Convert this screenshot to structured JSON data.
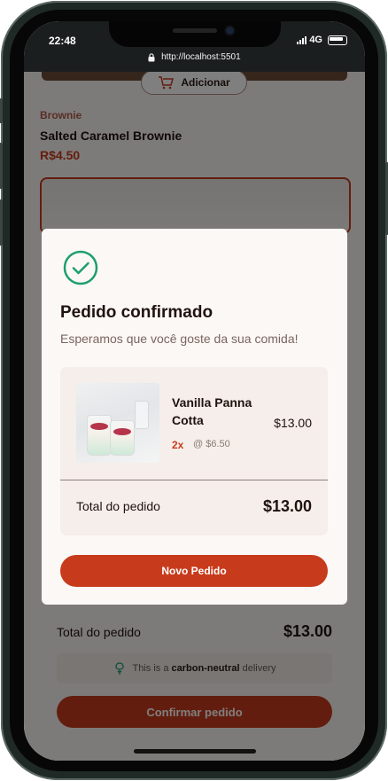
{
  "statusbar": {
    "time": "22:48",
    "network": "4G"
  },
  "browser": {
    "url": "http://localhost:5501"
  },
  "product": {
    "add_label": "Adicionar",
    "category": "Brownie",
    "name": "Salted Caramel Brownie",
    "price": "R$4.50"
  },
  "cart": {
    "total_label": "Total do pedido",
    "total_value": "$13.00",
    "carbon_prefix": "This is a",
    "carbon_bold": "carbon-neutral",
    "carbon_suffix": "delivery",
    "confirm_label": "Confirmar pedido"
  },
  "modal": {
    "title": "Pedido confirmado",
    "subtitle": "Esperamos que você goste da sua comida!",
    "items": [
      {
        "name": "Vanilla Panna Cotta",
        "qty": "2x",
        "unit_price": "@ $6.50",
        "total": "$13.00"
      }
    ],
    "total_label": "Total do pedido",
    "total_value": "$13.00",
    "new_order_label": "Novo Pedido"
  },
  "colors": {
    "accent": "#c73b1c",
    "success": "#1e9e6f",
    "background": "#fcf8f5"
  }
}
